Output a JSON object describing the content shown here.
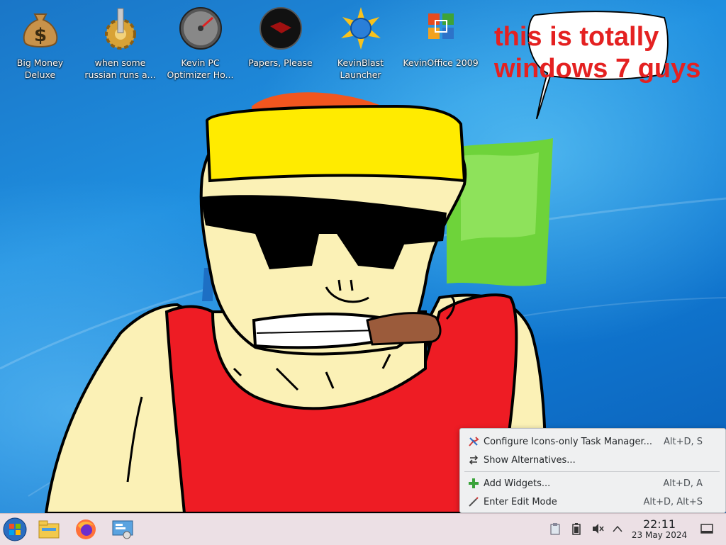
{
  "desktop_icons": [
    {
      "label": "Big Money Deluxe",
      "icon": "money-bag-icon"
    },
    {
      "label": "when some russian runs a...",
      "icon": "gear-icon"
    },
    {
      "label": "Kevin PC Optimizer Ho...",
      "icon": "speedometer-icon"
    },
    {
      "label": "Papers, Please",
      "icon": "papers-please-icon"
    },
    {
      "label": "KevinBlast Launcher",
      "icon": "burst-globe-icon"
    },
    {
      "label": "KevinOffice 2009",
      "icon": "office-logo-icon"
    }
  ],
  "bubble_text": "this is totally windows 7 guys",
  "context_menu": {
    "items": [
      {
        "label": "Configure Icons-only Task Manager...",
        "shortcut": "Alt+D, S",
        "icon": "configure-icon"
      },
      {
        "label": "Show Alternatives...",
        "shortcut": "",
        "icon": "alternatives-icon"
      },
      {
        "label": "Add Widgets...",
        "shortcut": "Alt+D, A",
        "icon": "add-icon"
      },
      {
        "label": "Enter Edit Mode",
        "shortcut": "Alt+D, Alt+S",
        "icon": "edit-mode-icon"
      }
    ]
  },
  "taskbar": {
    "apps": [
      "start-orb-icon",
      "file-manager-icon",
      "firefox-icon",
      "system-settings-icon"
    ],
    "tray_icons": [
      "clipboard-icon",
      "battery-icon",
      "volume-muted-icon",
      "chevron-up-icon"
    ],
    "clock": {
      "time": "22:11",
      "date": "23 May 2024"
    },
    "show_desktop": "show-desktop-icon"
  },
  "colors": {
    "bubble_text": "#e42121",
    "taskbar_bg": "#ebdfe4",
    "menu_bg": "#eff0f1"
  }
}
